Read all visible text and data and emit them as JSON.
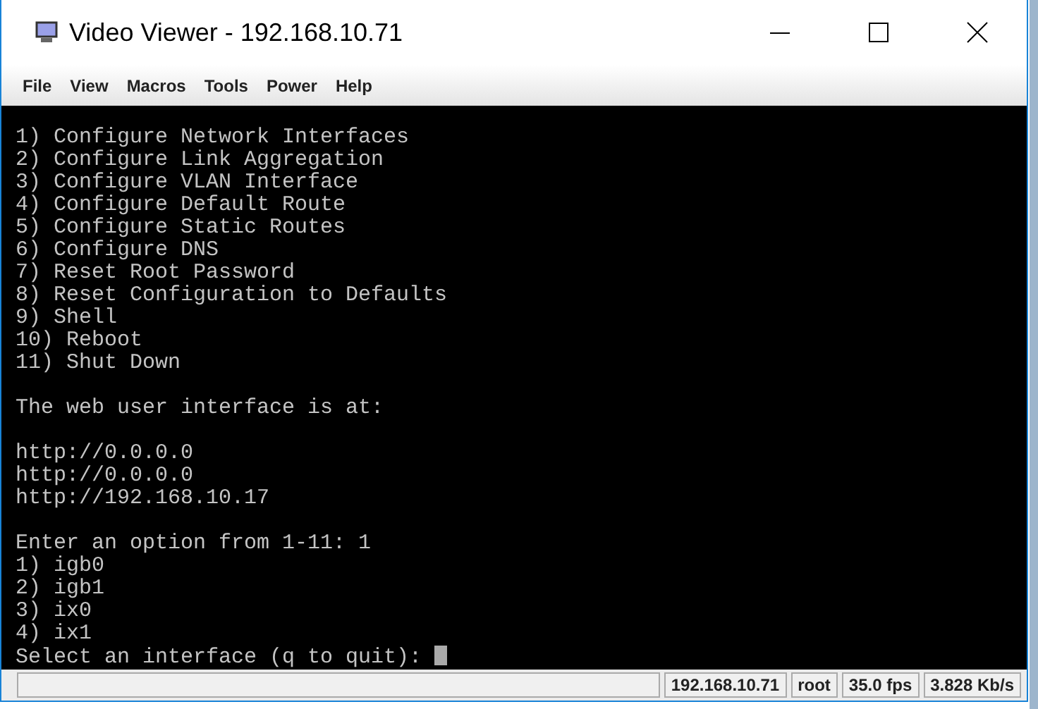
{
  "window": {
    "title": "Video Viewer - 192.168.10.71"
  },
  "menu": [
    "File",
    "View",
    "Macros",
    "Tools",
    "Power",
    "Help"
  ],
  "terminal": {
    "blocks": [
      [
        "1) Configure Network Interfaces",
        "2) Configure Link Aggregation",
        "3) Configure VLAN Interface",
        "4) Configure Default Route",
        "5) Configure Static Routes",
        "6) Configure DNS",
        "7) Reset Root Password",
        "8) Reset Configuration to Defaults",
        "9) Shell",
        "10) Reboot",
        "11) Shut Down"
      ],
      [
        "The web user interface is at:"
      ],
      [
        "http://0.0.0.0",
        "http://0.0.0.0",
        "http://192.168.10.17"
      ],
      [
        "Enter an option from 1-11: 1",
        "1) igb0",
        "2) igb1",
        "3) ix0",
        "4) ix1",
        "Select an interface (q to quit): "
      ]
    ]
  },
  "status_bar": [
    "192.168.10.71",
    "root",
    "35.0 fps",
    "3.828 Kb/s"
  ]
}
